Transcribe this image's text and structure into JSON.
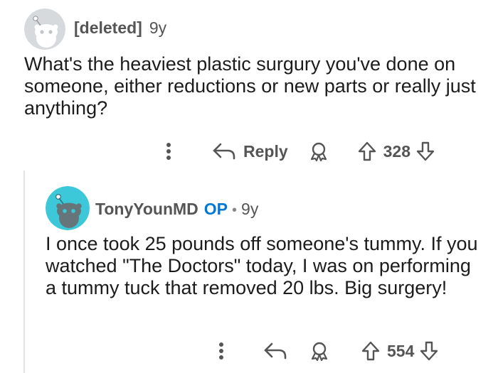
{
  "comment": {
    "username": "[deleted]",
    "age": "9y",
    "text": "What's the heaviest plastic surgury you've done on someone, either reductions or new parts or really just anything?",
    "reply_label": "Reply",
    "score": "328"
  },
  "reply": {
    "username": "TonyYounMD",
    "op_badge": "OP",
    "separator": "•",
    "age": "9y",
    "text": "I once took 25 pounds off someone's tummy. If you watched \"The Doctors\" today, I was on performing a tummy tuck that removed 20 lbs. Big surgery!",
    "score": "554"
  },
  "colors": {
    "op_blue": "#0079d3",
    "avatar_teal": "#3cc8d8",
    "avatar_gray": "#d7dadc"
  },
  "icons": [
    "more-options-icon",
    "reply-arrow-icon",
    "award-icon",
    "upvote-icon",
    "downvote-icon",
    "snoo-avatar-icon"
  ]
}
